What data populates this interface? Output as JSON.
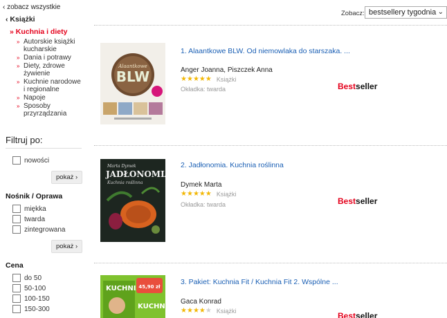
{
  "sidebar": {
    "see_all": "‹ zobacz wszystkie",
    "books": "‹ Książki",
    "active_category": "» Kuchnia i diety",
    "subcategories": [
      [
        "Autorskie książki",
        "kucharskie"
      ],
      [
        "Dania i potrawy"
      ],
      [
        "Diety, zdrowe",
        "żywienie"
      ],
      [
        "Kuchnie narodowe",
        "i regionalne"
      ],
      [
        "Napoje"
      ],
      [
        "Sposoby",
        "przyrządzania"
      ]
    ],
    "filter_title": "Filtruj po:",
    "new_label": "nowości",
    "show_button": "pokaż ›",
    "media_title": "Nośnik / Oprawa",
    "media_options": [
      "miękka",
      "twarda",
      "zintegrowana"
    ],
    "price_title": "Cena",
    "price_options": [
      "do 50",
      "50-100",
      "100-150",
      "150-300"
    ]
  },
  "sort": {
    "label": "Zobacz:",
    "value": "bestsellery tygodnia"
  },
  "products": [
    {
      "title": "1. Alaantkowe BLW. Od niemowlaka do starszaka. ...",
      "author": "Anger Joanna, Piszczek Anna",
      "rating": 4.5,
      "kind": "Książki",
      "cover_type": "Okładka: twarda",
      "badge_red": "Best",
      "badge_black": "seller",
      "cover_title": "BLW",
      "cover_subtitle": "Alaantkowe"
    },
    {
      "title": "2. Jadłonomia. Kuchnia roślinna",
      "author": "Dymek Marta",
      "rating": 5,
      "kind": "Książki",
      "cover_type": "Okładka: twarda",
      "badge_red": "Best",
      "badge_black": "seller",
      "cover_title": "JADŁONOMIA",
      "cover_author": "Marta Dymek",
      "cover_subtitle": "Kuchnia roślinna"
    },
    {
      "title": "3. Pakiet: Kuchnia Fit / Kuchnia Fit 2. Wspólne ...",
      "author": "Gaca Konrad",
      "rating": 4,
      "kind": "Książki",
      "badge_red": "Best",
      "badge_black": "seller",
      "cover_title": "KUCHNIA",
      "cover_title_2": "KUCHNIA",
      "cover_price": "45,90 zł"
    }
  ],
  "colors": {
    "accent_red": "#e4001b",
    "link_blue": "#1a5fb4",
    "star_gold": "#f2b705"
  }
}
